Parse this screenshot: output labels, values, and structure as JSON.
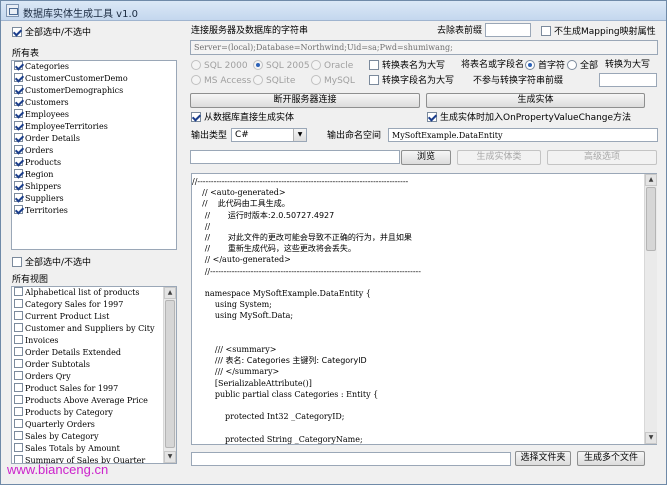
{
  "window": {
    "title": "数据库实体生成工具 v1.0"
  },
  "left": {
    "select_all_tables": "全部选中/不选中",
    "tables_label": "所有表",
    "tables": [
      "Categories",
      "CustomerCustomerDemo",
      "CustomerDemographics",
      "Customers",
      "Employees",
      "EmployeeTerritories",
      "Order Details",
      "Orders",
      "Products",
      "Region",
      "Shippers",
      "Suppliers",
      "Territories"
    ],
    "select_all_views": "全部选中/不选中",
    "views_label": "所有视图",
    "views": [
      "Alphabetical list of products",
      "Category Sales for 1997",
      "Current Product List",
      "Customer and Suppliers by City",
      "Invoices",
      "Order Details Extended",
      "Order Subtotals",
      "Orders Qry",
      "Product Sales for 1997",
      "Products Above Average Price",
      "Products by Category",
      "Quarterly Orders",
      "Sales by Category",
      "Sales Totals by Amount",
      "Summary of Sales by Quarter"
    ]
  },
  "connection": {
    "label": "连接服务器及数据库的字符串",
    "value": "Server=(local);Database=Northwind;Uid=sa;Pwd=shumiwang;",
    "remove_prefix_label": "去除表前缀",
    "remove_prefix_value": "",
    "no_mapping_label": "不生成Mapping映射属性"
  },
  "db_types": {
    "sql2000": "SQL 2000",
    "sql2005": "SQL 2005",
    "oracle": "Oracle",
    "ms_access": "MS Access",
    "sqlite": "SQLite",
    "mysql": "MySQL"
  },
  "options": {
    "table_upper": "转换表名为大写",
    "field_upper": "转换字段名为大写",
    "convert_label": "将表名或字段名",
    "first_char": "首字符",
    "all": "全部",
    "to_upper": "转换为大写",
    "no_prefix_label": "不参与转换字符串前缀",
    "no_prefix_value": ""
  },
  "actions": {
    "disconnect": "断开服务器连接",
    "generate": "生成实体",
    "direct_gen": "从数据库直接生成实体",
    "add_change": "生成实体时加入OnPropertyValueChange方法"
  },
  "output": {
    "type_label": "输出类型",
    "type_value": "C#",
    "ns_label": "输出命名空间",
    "ns_value": "MySoftExample.DataEntity",
    "path_value": "",
    "browse": "浏览",
    "gen_entity": "生成实体类",
    "advanced": "高级选项"
  },
  "code_lines": [
    "//------------------------------------------------------------------------------",
    "    // <auto-generated>",
    "    //    此代码由工具生成。",
    "     //       运行时版本:2.0.50727.4927",
    "     //",
    "     //       对此文件的更改可能会导致不正确的行为，并且如果",
    "     //       重新生成代码，这些更改将会丢失。",
    "     // </auto-generated>",
    "     //------------------------------------------------------------------------------",
    "",
    "     namespace MySoftExample.DataEntity {",
    "         using System;",
    "         using MySoft.Data;",
    "",
    "",
    "         /// <summary>",
    "         /// 表名: Categories 主键列: CategoryID",
    "         /// </summary>",
    "         [SerializableAttribute()]",
    "         public partial class Categories : Entity {",
    "",
    "             protected Int32 _CategoryID;",
    "",
    "             protected String _CategoryName;"
  ],
  "bottom": {
    "file_value": "",
    "choose_file": "选择文件夹",
    "gen_multi": "生成多个文件"
  },
  "watermark": "www.bianceng.cn"
}
